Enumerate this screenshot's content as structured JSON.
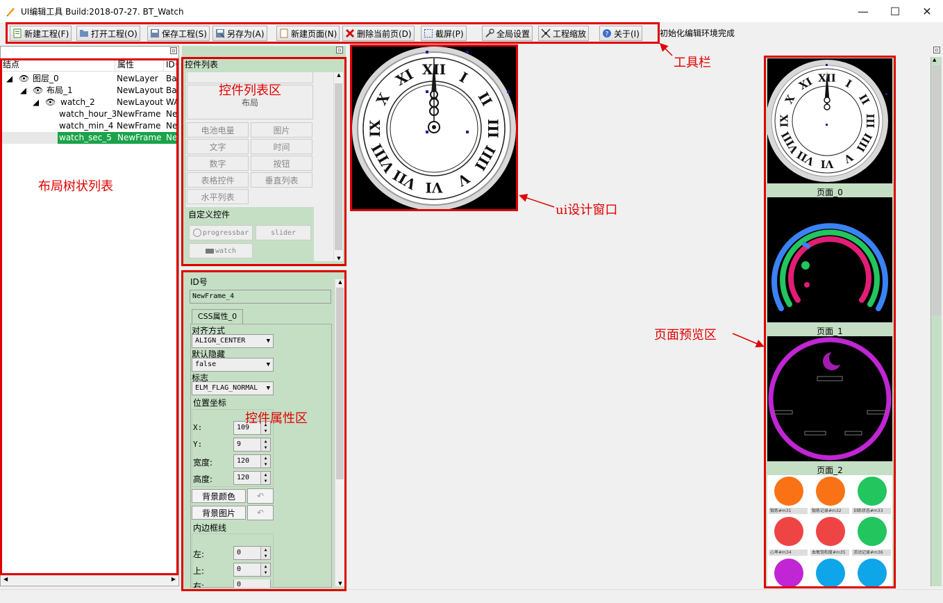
{
  "window": {
    "title": "UI编辑工具 Build:2018-07-27.  BT_Watch",
    "min_symbol": "—",
    "max_symbol": "☐",
    "close_symbol": "✕"
  },
  "toolbar": {
    "buttons": [
      {
        "label": "新建工程(F)",
        "icon": "new-project-icon"
      },
      {
        "label": "打开工程(O)",
        "icon": "open-project-icon"
      },
      {
        "label": "保存工程(S)",
        "icon": "save-project-icon"
      },
      {
        "label": "另存为(A)",
        "icon": "save-as-icon"
      },
      {
        "label": "新建页面(N)",
        "icon": "new-page-icon"
      },
      {
        "label": "删除当前页(D)",
        "icon": "delete-page-icon"
      },
      {
        "label": "截屏(P)",
        "icon": "screenshot-icon"
      },
      {
        "label": "全局设置",
        "icon": "settings-icon"
      },
      {
        "label": "工程缩放",
        "icon": "scale-icon"
      },
      {
        "label": "关于(I)",
        "icon": "about-icon"
      }
    ],
    "status": "初始化编辑环境完成"
  },
  "annotations": {
    "toolbar": "工具栏",
    "tree": "布局树状列表",
    "widget_list": "控件列表区",
    "props": "控件属性区",
    "design": "ui设计窗口",
    "preview": "页面预览区"
  },
  "tree": {
    "headers": [
      "结点",
      "属性",
      "ID号"
    ],
    "rows": [
      {
        "name": "图层_0",
        "attr": "NewLayer",
        "id": "Bas"
      },
      {
        "name": "布局_1",
        "attr": "NewLayout",
        "id": "Bas"
      },
      {
        "name": "watch_2",
        "attr": "NewLayout",
        "id": "WA"
      },
      {
        "name": "watch_hour_3",
        "attr": "NewFrame",
        "id": "Ne"
      },
      {
        "name": "watch_min_4",
        "attr": "NewFrame",
        "id": "Ne"
      },
      {
        "name": "watch_sec_5",
        "attr": "NewFrame",
        "id": "Ne"
      }
    ]
  },
  "widget_list": {
    "title": "控件列表",
    "layout_label": "布局",
    "items": [
      "电池电量",
      "图片",
      "文字",
      "时间",
      "数字",
      "按钮",
      "表格控件",
      "垂直列表",
      "水平列表"
    ],
    "custom_header": "自定义控件",
    "custom_items": [
      "progressbar",
      "slider",
      "watch"
    ]
  },
  "props": {
    "id_label": "ID号",
    "id_value": "NewFrame_4",
    "tab": "CSS属性_0",
    "align_label": "对齐方式",
    "align_value": "ALIGN_CENTER",
    "hidden_label": "默认隐藏",
    "hidden_value": "false",
    "flag_label": "标志",
    "flag_value": "ELM_FLAG_NORMAL",
    "pos_label": "位置坐标",
    "x_label": "X:",
    "x_value": "109",
    "y_label": "Y:",
    "y_value": "9",
    "w_label": "宽度:",
    "w_value": "120",
    "h_label": "高度:",
    "h_value": "120",
    "bgcolor_btn": "背景颜色",
    "bgimg_btn": "背景图片",
    "padding_label": "内边框线",
    "left_label": "左:",
    "left_value": "0",
    "top_label": "上:",
    "top_value": "0",
    "right_label": "右:",
    "right_value": "0"
  },
  "preview": {
    "pages": [
      "页面_0",
      "页面_1",
      "页面_2"
    ],
    "apps": [
      {
        "label": "锻炼#m31",
        "color": "#f97316"
      },
      {
        "label": "锻炼记录#m32",
        "color": "#f97316"
      },
      {
        "label": "训练状态#m33",
        "color": "#22c55e"
      },
      {
        "label": "心率#m34",
        "color": "#ef4444"
      },
      {
        "label": "血氧饱和度#m35",
        "color": "#ef4444"
      },
      {
        "label": "活动记录#m36",
        "color": "#22c55e"
      },
      {
        "label": "",
        "color": "#c026d3"
      },
      {
        "label": "",
        "color": "#0ea5e9"
      },
      {
        "label": "",
        "color": "#0ea5e9"
      }
    ]
  },
  "clock": {
    "numerals": [
      "XII",
      "I",
      "II",
      "III",
      "IIII",
      "V",
      "VI",
      "VII",
      "VIII",
      "IX",
      "X",
      "XI"
    ]
  }
}
